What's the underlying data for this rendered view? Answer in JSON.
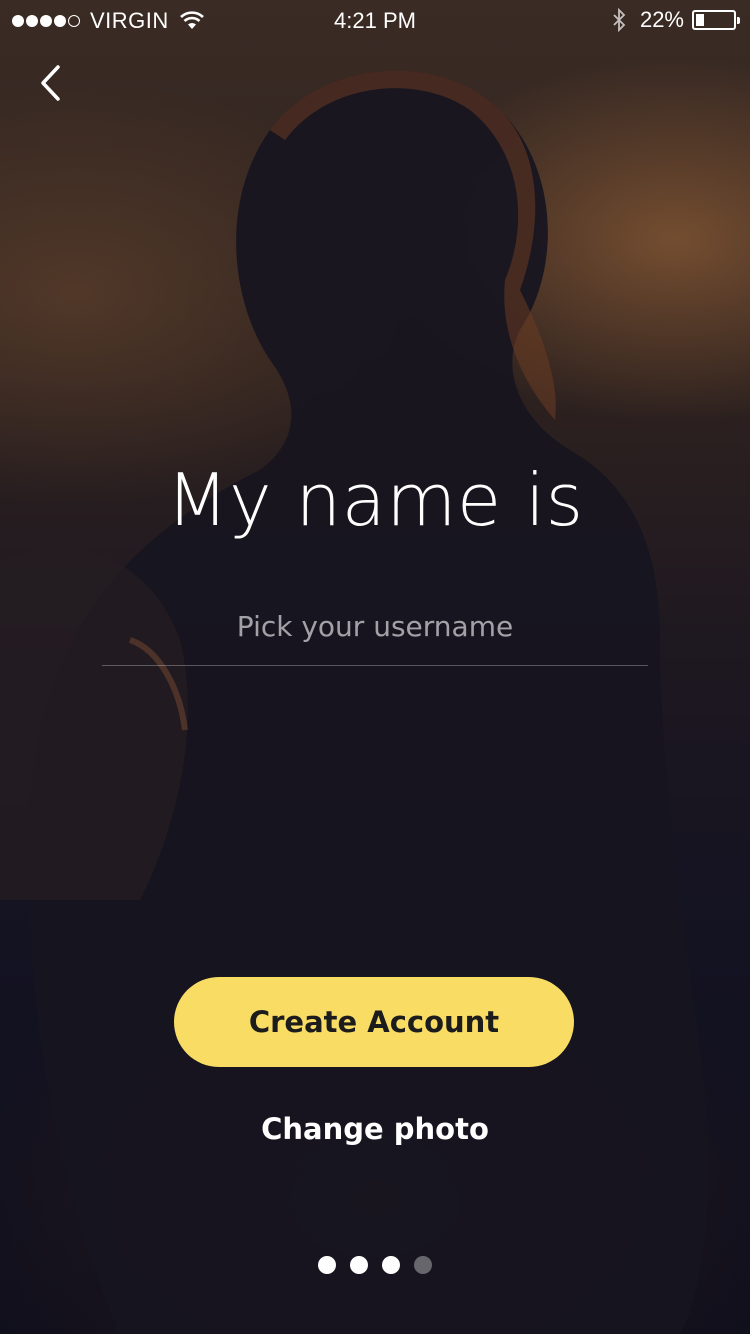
{
  "status_bar": {
    "carrier": "VIRGIN",
    "signal_bars_filled": 4,
    "signal_bars_total": 5,
    "time": "4:21 PM",
    "battery_percent": "22%",
    "battery_level": 0.22
  },
  "nav": {
    "back_icon": "chevron-left-icon"
  },
  "headline": "My name is",
  "username": {
    "placeholder": "Pick your username",
    "value": ""
  },
  "actions": {
    "create_account_label": "Create Account",
    "change_photo_label": "Change photo"
  },
  "pager": {
    "total": 4,
    "active_indices": [
      0,
      1,
      2
    ]
  },
  "colors": {
    "accent": "#f8dc63",
    "background_dark": "#100f1c",
    "text": "#ffffff"
  }
}
